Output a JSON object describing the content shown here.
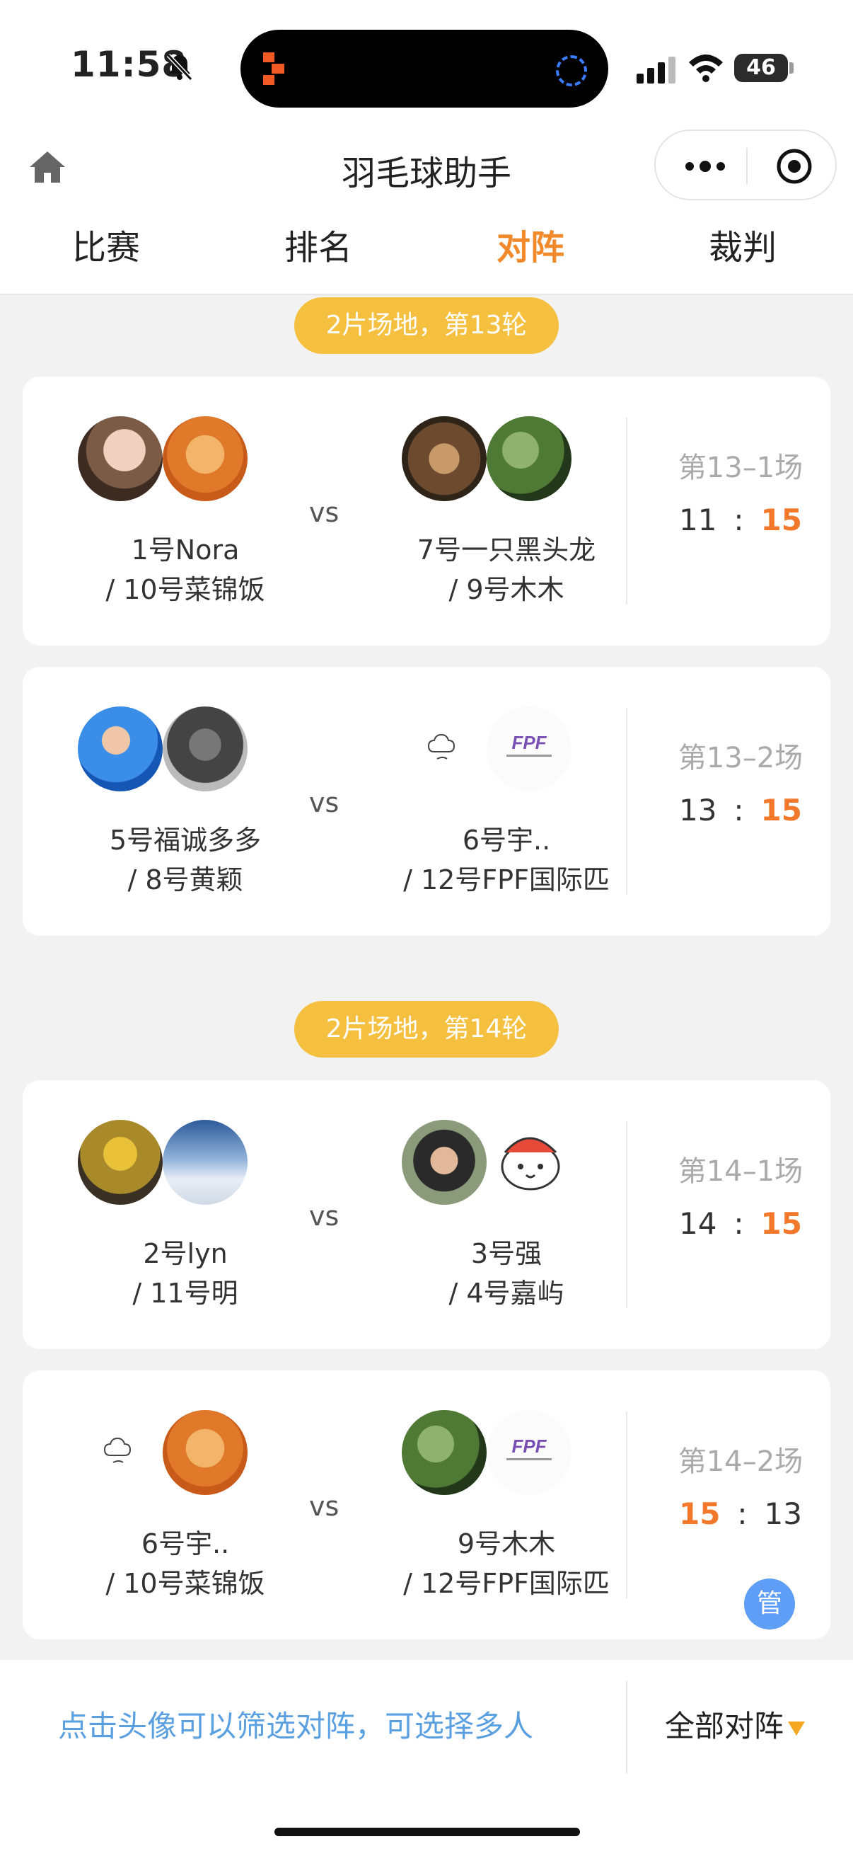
{
  "status_bar": {
    "time": "11:58",
    "battery": "46"
  },
  "nav": {
    "title": "羽毛球助手"
  },
  "tabs": [
    {
      "label": "比赛",
      "active": false
    },
    {
      "label": "排名",
      "active": false
    },
    {
      "label": "对阵",
      "active": true
    },
    {
      "label": "裁判",
      "active": false
    }
  ],
  "rounds": [
    {
      "label": "2片场地，第13轮"
    },
    {
      "label": "2片场地，第14轮"
    }
  ],
  "matches": [
    {
      "left": {
        "name1": "1号Nora",
        "name2": "/ 10号菜锦饭"
      },
      "vs": "vs",
      "right": {
        "name1": "7号一只黑头龙",
        "name2": "/ 9号木木"
      },
      "label": "第13–1场",
      "score_left": "11",
      "score_sep": ":",
      "score_right": "15"
    },
    {
      "left": {
        "name1": "5号福诚多多",
        "name2": "/ 8号黄颖"
      },
      "vs": "vs",
      "right": {
        "name1": "6号宇..",
        "name2": "/ 12号FPF国际匹"
      },
      "label": "第13–2场",
      "score_left": "13",
      "score_sep": ":",
      "score_right": "15"
    },
    {
      "left": {
        "name1": "2号lyn",
        "name2": "/ 11号明"
      },
      "vs": "vs",
      "right": {
        "name1": "3号强",
        "name2": "/ 4号嘉屿"
      },
      "label": "第14–1场",
      "score_left": "14",
      "score_sep": ":",
      "score_right": "15"
    },
    {
      "left": {
        "name1": "6号宇..",
        "name2": "/ 10号菜锦饭"
      },
      "vs": "vs",
      "right": {
        "name1": "9号木木",
        "name2": "/ 12号FPF国际匹"
      },
      "label": "第14–2场",
      "score_left": "15",
      "score_sep": ":",
      "score_right": "13",
      "manage_label": "管"
    }
  ],
  "footer": {
    "hint": "点击头像可以筛选对阵，可选择多人",
    "filter_label": "全部对阵"
  },
  "colors": {
    "accent": "#f28a2c",
    "badge": "#f5c040",
    "hint": "#5aa0e0",
    "manage": "#5f9ef6"
  }
}
